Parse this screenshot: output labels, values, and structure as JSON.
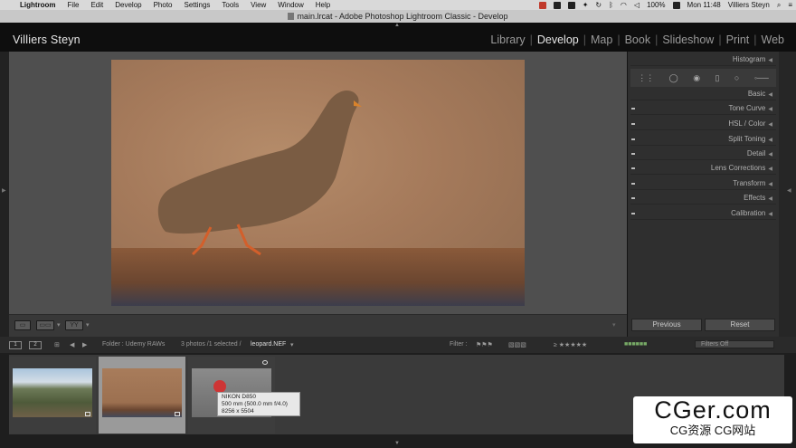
{
  "menubar": {
    "app_name": "Lightroom",
    "items": [
      "File",
      "Edit",
      "Develop",
      "Photo",
      "Settings",
      "Tools",
      "View",
      "Window",
      "Help"
    ],
    "battery": "100%",
    "clock": "Mon 11:48",
    "user": "Villiers Steyn"
  },
  "window": {
    "title": "main.lrcat - Adobe Photoshop Lightroom Classic - Develop"
  },
  "identity": {
    "plate": "Villiers Steyn"
  },
  "modules": [
    {
      "label": "Library",
      "active": false
    },
    {
      "label": "Develop",
      "active": true
    },
    {
      "label": "Map",
      "active": false
    },
    {
      "label": "Book",
      "active": false
    },
    {
      "label": "Slideshow",
      "active": false
    },
    {
      "label": "Print",
      "active": false
    },
    {
      "label": "Web",
      "active": false
    }
  ],
  "right_panel": {
    "histogram": "Histogram",
    "sections": [
      "Basic",
      "Tone Curve",
      "HSL / Color",
      "Split Toning",
      "Detail",
      "Lens Corrections",
      "Transform",
      "Effects",
      "Calibration"
    ],
    "previous_button": "Previous",
    "reset_button": "Reset"
  },
  "filmstrip_bar": {
    "page1": "1",
    "page2": "2",
    "source": "Folder : Udemy RAWs",
    "count": "3 photos /1 selected /",
    "filename": "leopard.NEF",
    "filter_label": "Filter :",
    "filters_off": "Filters Off"
  },
  "tooltip": {
    "line1": "NIKON D850",
    "line2": "500 mm (500.0 mm f/4.0)",
    "line3": "8256 x 5504"
  },
  "watermark": {
    "big": "CGer.com",
    "small": "CG资源 CG网站"
  },
  "colors": {
    "background": "#141414",
    "panel": "#2f2f2f",
    "center": "#4f4f4f"
  }
}
